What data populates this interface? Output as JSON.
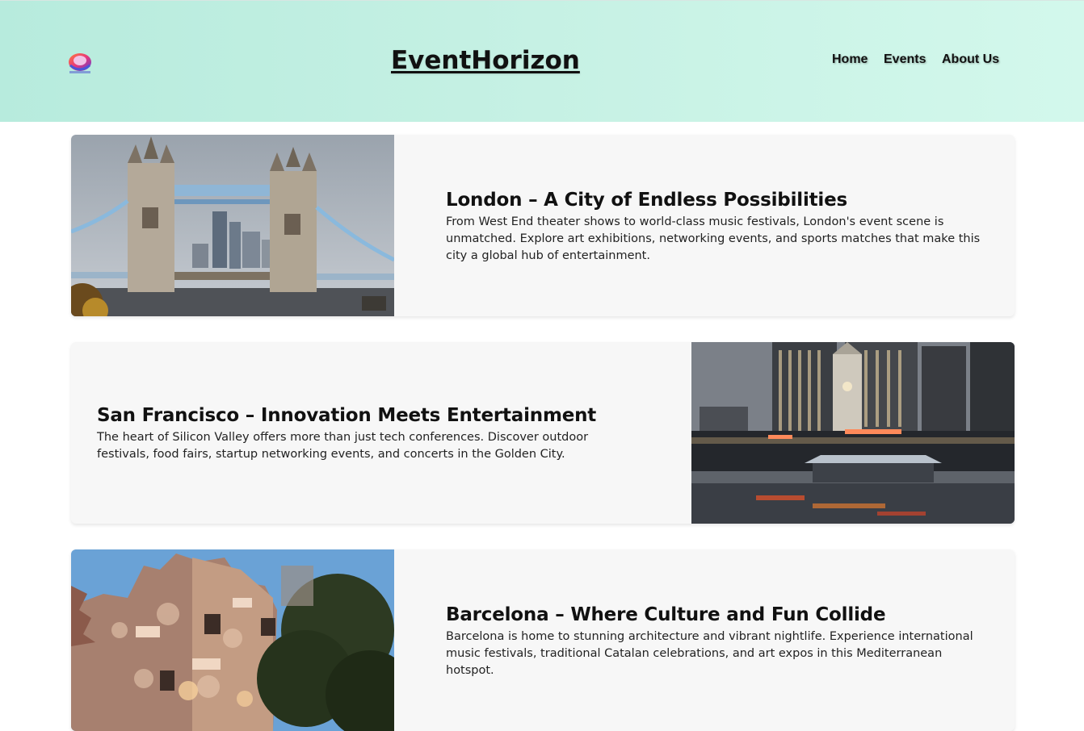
{
  "header": {
    "brand": "EventHorizon",
    "nav": [
      {
        "label": "Home"
      },
      {
        "label": "Events"
      },
      {
        "label": "About Us"
      }
    ]
  },
  "cards": [
    {
      "title": "London – A City of Endless Possibilities",
      "body": "From West End theater shows to world-class music festivals, London's event scene is unmatched. Explore art exhibitions, networking events, and sports matches that make this city a global hub of entertainment."
    },
    {
      "title": "San Francisco – Innovation Meets Entertainment",
      "body": "The heart of Silicon Valley offers more than just tech conferences. Discover outdoor festivals, food fairs, startup networking events, and concerts in the Golden City."
    },
    {
      "title": "Barcelona – Where Culture and Fun Collide",
      "body": "Barcelona is home to stunning architecture and vibrant nightlife. Experience international music festivals, traditional Catalan celebrations, and art expos in this Mediterranean hotspot."
    }
  ]
}
